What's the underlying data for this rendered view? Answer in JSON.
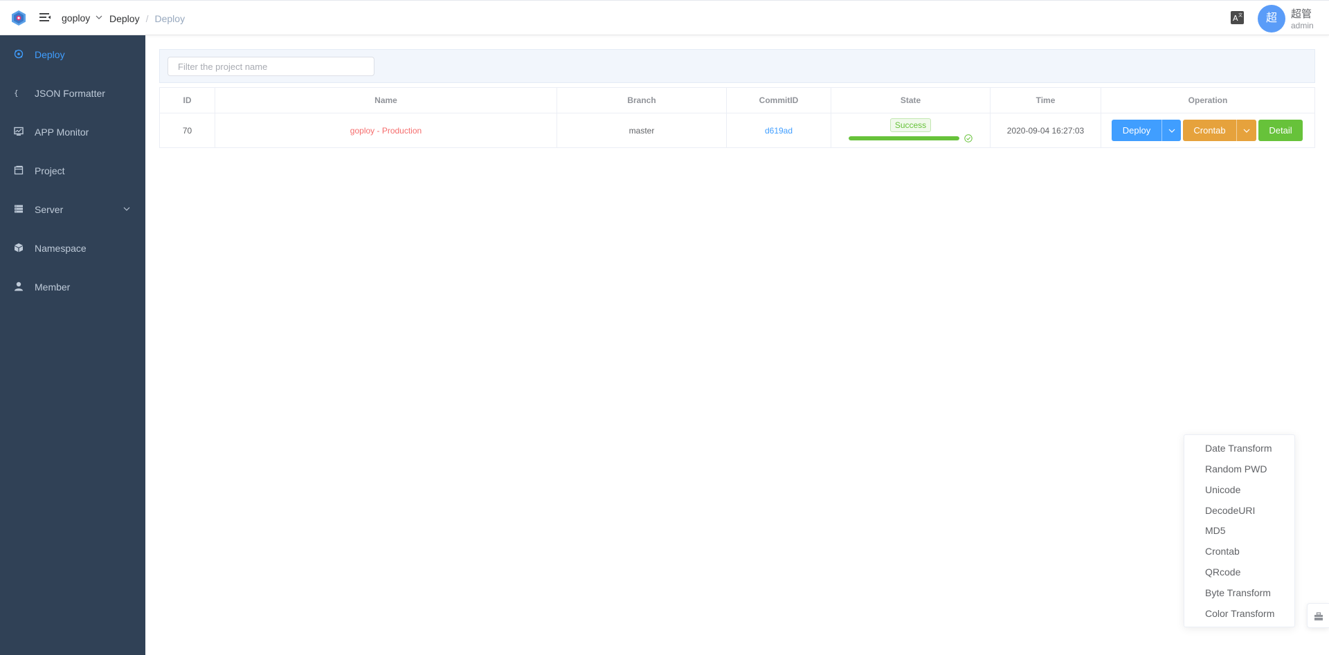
{
  "header": {
    "namespace": "goploy",
    "breadcrumb": [
      "Deploy",
      "Deploy"
    ],
    "breadcrumb_sep": "/",
    "user": {
      "avatar_text": "超",
      "name": "超管",
      "role": "admin"
    }
  },
  "sidebar": {
    "items": [
      {
        "label": "Deploy",
        "icon": "deploy-icon",
        "active": true
      },
      {
        "label": "JSON Formatter",
        "icon": "braces-icon"
      },
      {
        "label": "APP Monitor",
        "icon": "monitor-icon"
      },
      {
        "label": "Project",
        "icon": "project-icon"
      },
      {
        "label": "Server",
        "icon": "server-icon",
        "has_submenu": true
      },
      {
        "label": "Namespace",
        "icon": "cube-icon"
      },
      {
        "label": "Member",
        "icon": "user-icon"
      }
    ]
  },
  "filter": {
    "placeholder": "Filter the project name",
    "value": ""
  },
  "table": {
    "columns": [
      "ID",
      "Name",
      "Branch",
      "CommitID",
      "State",
      "Time",
      "Operation"
    ],
    "rows": [
      {
        "id": "70",
        "name": "goploy - Production",
        "branch": "master",
        "commit": "d619ad",
        "state": "Success",
        "progress": 1.0,
        "time": "2020-09-04 16:27:03",
        "ops": {
          "deploy": "Deploy",
          "crontab": "Crontab",
          "detail": "Detail"
        }
      }
    ]
  },
  "float_menu": {
    "items": [
      "Date Transform",
      "Random PWD",
      "Unicode",
      "DecodeURI",
      "MD5",
      "Crontab",
      "QRcode",
      "Byte Transform",
      "Color Transform"
    ]
  },
  "colors": {
    "sidebar_bg": "#304156",
    "primary": "#409eff",
    "warning": "#e6a23c",
    "success": "#67c23a",
    "danger": "#f56c6c"
  }
}
